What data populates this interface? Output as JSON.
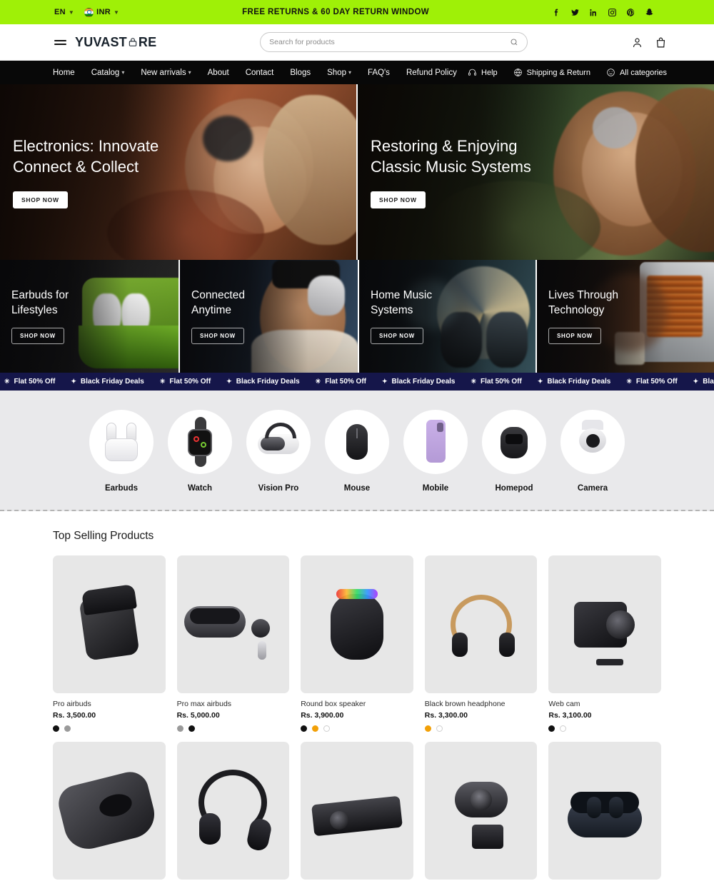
{
  "announcement": {
    "language": "EN",
    "currency": "INR",
    "message": "FREE RETURNS & 60 DAY RETURN WINDOW",
    "socials": [
      "facebook-icon",
      "twitter-icon",
      "linkedin-icon",
      "instagram-icon",
      "pinterest-icon",
      "snapchat-icon"
    ],
    "bg_color": "#9ff007"
  },
  "header": {
    "logo": "YUVAST",
    "logo_suffix": "RE",
    "search_placeholder": "Search for products",
    "search_value": "",
    "account_icon": "user-icon",
    "cart_icon": "shopping-bag-icon"
  },
  "nav": {
    "items": [
      {
        "label": "Home",
        "has_caret": false
      },
      {
        "label": "Catalog",
        "has_caret": true
      },
      {
        "label": "New arrivals",
        "has_caret": true
      },
      {
        "label": "About",
        "has_caret": false
      },
      {
        "label": "Contact",
        "has_caret": false
      },
      {
        "label": "Blogs",
        "has_caret": false
      },
      {
        "label": "Shop",
        "has_caret": true
      },
      {
        "label": "FAQ's",
        "has_caret": false
      },
      {
        "label": "Refund Policy",
        "has_caret": false
      }
    ],
    "utilities": [
      {
        "label": "Help",
        "icon": "headset-icon"
      },
      {
        "label": "Shipping & Return",
        "icon": "globe-icon"
      },
      {
        "label": "All categories",
        "icon": "smiley-icon"
      }
    ]
  },
  "heroes": [
    {
      "title": "Electronics: Innovate Connect & Collect",
      "cta": "SHOP NOW"
    },
    {
      "title": "Restoring & Enjoying Classic Music Systems",
      "cta": "SHOP NOW"
    }
  ],
  "cards": [
    {
      "title": "Earbuds for Lifestyles",
      "cta": "SHOP NOW"
    },
    {
      "title": "Connected Anytime",
      "cta": "SHOP NOW"
    },
    {
      "title": "Home Music Systems",
      "cta": "SHOP NOW"
    },
    {
      "title": "Lives Through Technology",
      "cta": "SHOP NOW"
    }
  ],
  "marquee": {
    "bg_color": "#15164a",
    "items": [
      {
        "glyph": "✳",
        "label": "Flat 50% Off"
      },
      {
        "glyph": "✦",
        "label": "Black Friday Deals"
      },
      {
        "glyph": "✳",
        "label": "Flat 50% Off"
      },
      {
        "glyph": "✦",
        "label": "Black Friday Deals"
      },
      {
        "glyph": "✳",
        "label": "Flat 50% Off"
      },
      {
        "glyph": "✦",
        "label": "Black Friday Deals"
      },
      {
        "glyph": "✳",
        "label": "Flat 50% Off"
      },
      {
        "glyph": "✦",
        "label": "Black Friday Deals"
      },
      {
        "glyph": "✳",
        "label": "Flat 50% Off"
      },
      {
        "glyph": "✦",
        "label": "Black Friday Deals"
      },
      {
        "glyph": "✳",
        "label": ""
      }
    ]
  },
  "categories": [
    {
      "label": "Earbuds",
      "icon": "earbuds-icon"
    },
    {
      "label": "Watch",
      "icon": "watch-icon"
    },
    {
      "label": "Vision Pro",
      "icon": "vision-pro-icon"
    },
    {
      "label": "Mouse",
      "icon": "mouse-icon"
    },
    {
      "label": "Mobile",
      "icon": "mobile-icon"
    },
    {
      "label": "Homepod",
      "icon": "homepod-icon"
    },
    {
      "label": "Camera",
      "icon": "camera-icon"
    }
  ],
  "products": {
    "section_title": "Top Selling Products",
    "row1": [
      {
        "name": "Pro airbuds",
        "price": "Rs. 3,500.00",
        "swatches": [
          "#111111",
          "#9a9a9a"
        ],
        "image": "airpods-case-black"
      },
      {
        "name": "Pro max airbuds",
        "price": "Rs. 5,000.00",
        "swatches": [
          "#9a9a9a",
          "#111111"
        ],
        "image": "earbuds-case-gray"
      },
      {
        "name": "Round box speaker",
        "price": "Rs. 3,900.00",
        "swatches": [
          "#111111",
          "#f2a007",
          "#ffffff"
        ],
        "image": "round-speaker-black"
      },
      {
        "name": "Black brown headphone",
        "price": "Rs. 3,300.00",
        "swatches": [
          "#f2a007",
          "#ffffff"
        ],
        "image": "headphone-black-brown"
      },
      {
        "name": "Web cam",
        "price": "Rs. 3,100.00",
        "swatches": [
          "#111111",
          "#ffffff"
        ],
        "image": "webcam-black"
      }
    ],
    "row2": [
      {
        "image": "mouse-black"
      },
      {
        "image": "headphone-black"
      },
      {
        "image": "projector-black"
      },
      {
        "image": "webcam-clip"
      },
      {
        "image": "earbuds-case-navy"
      }
    ]
  }
}
